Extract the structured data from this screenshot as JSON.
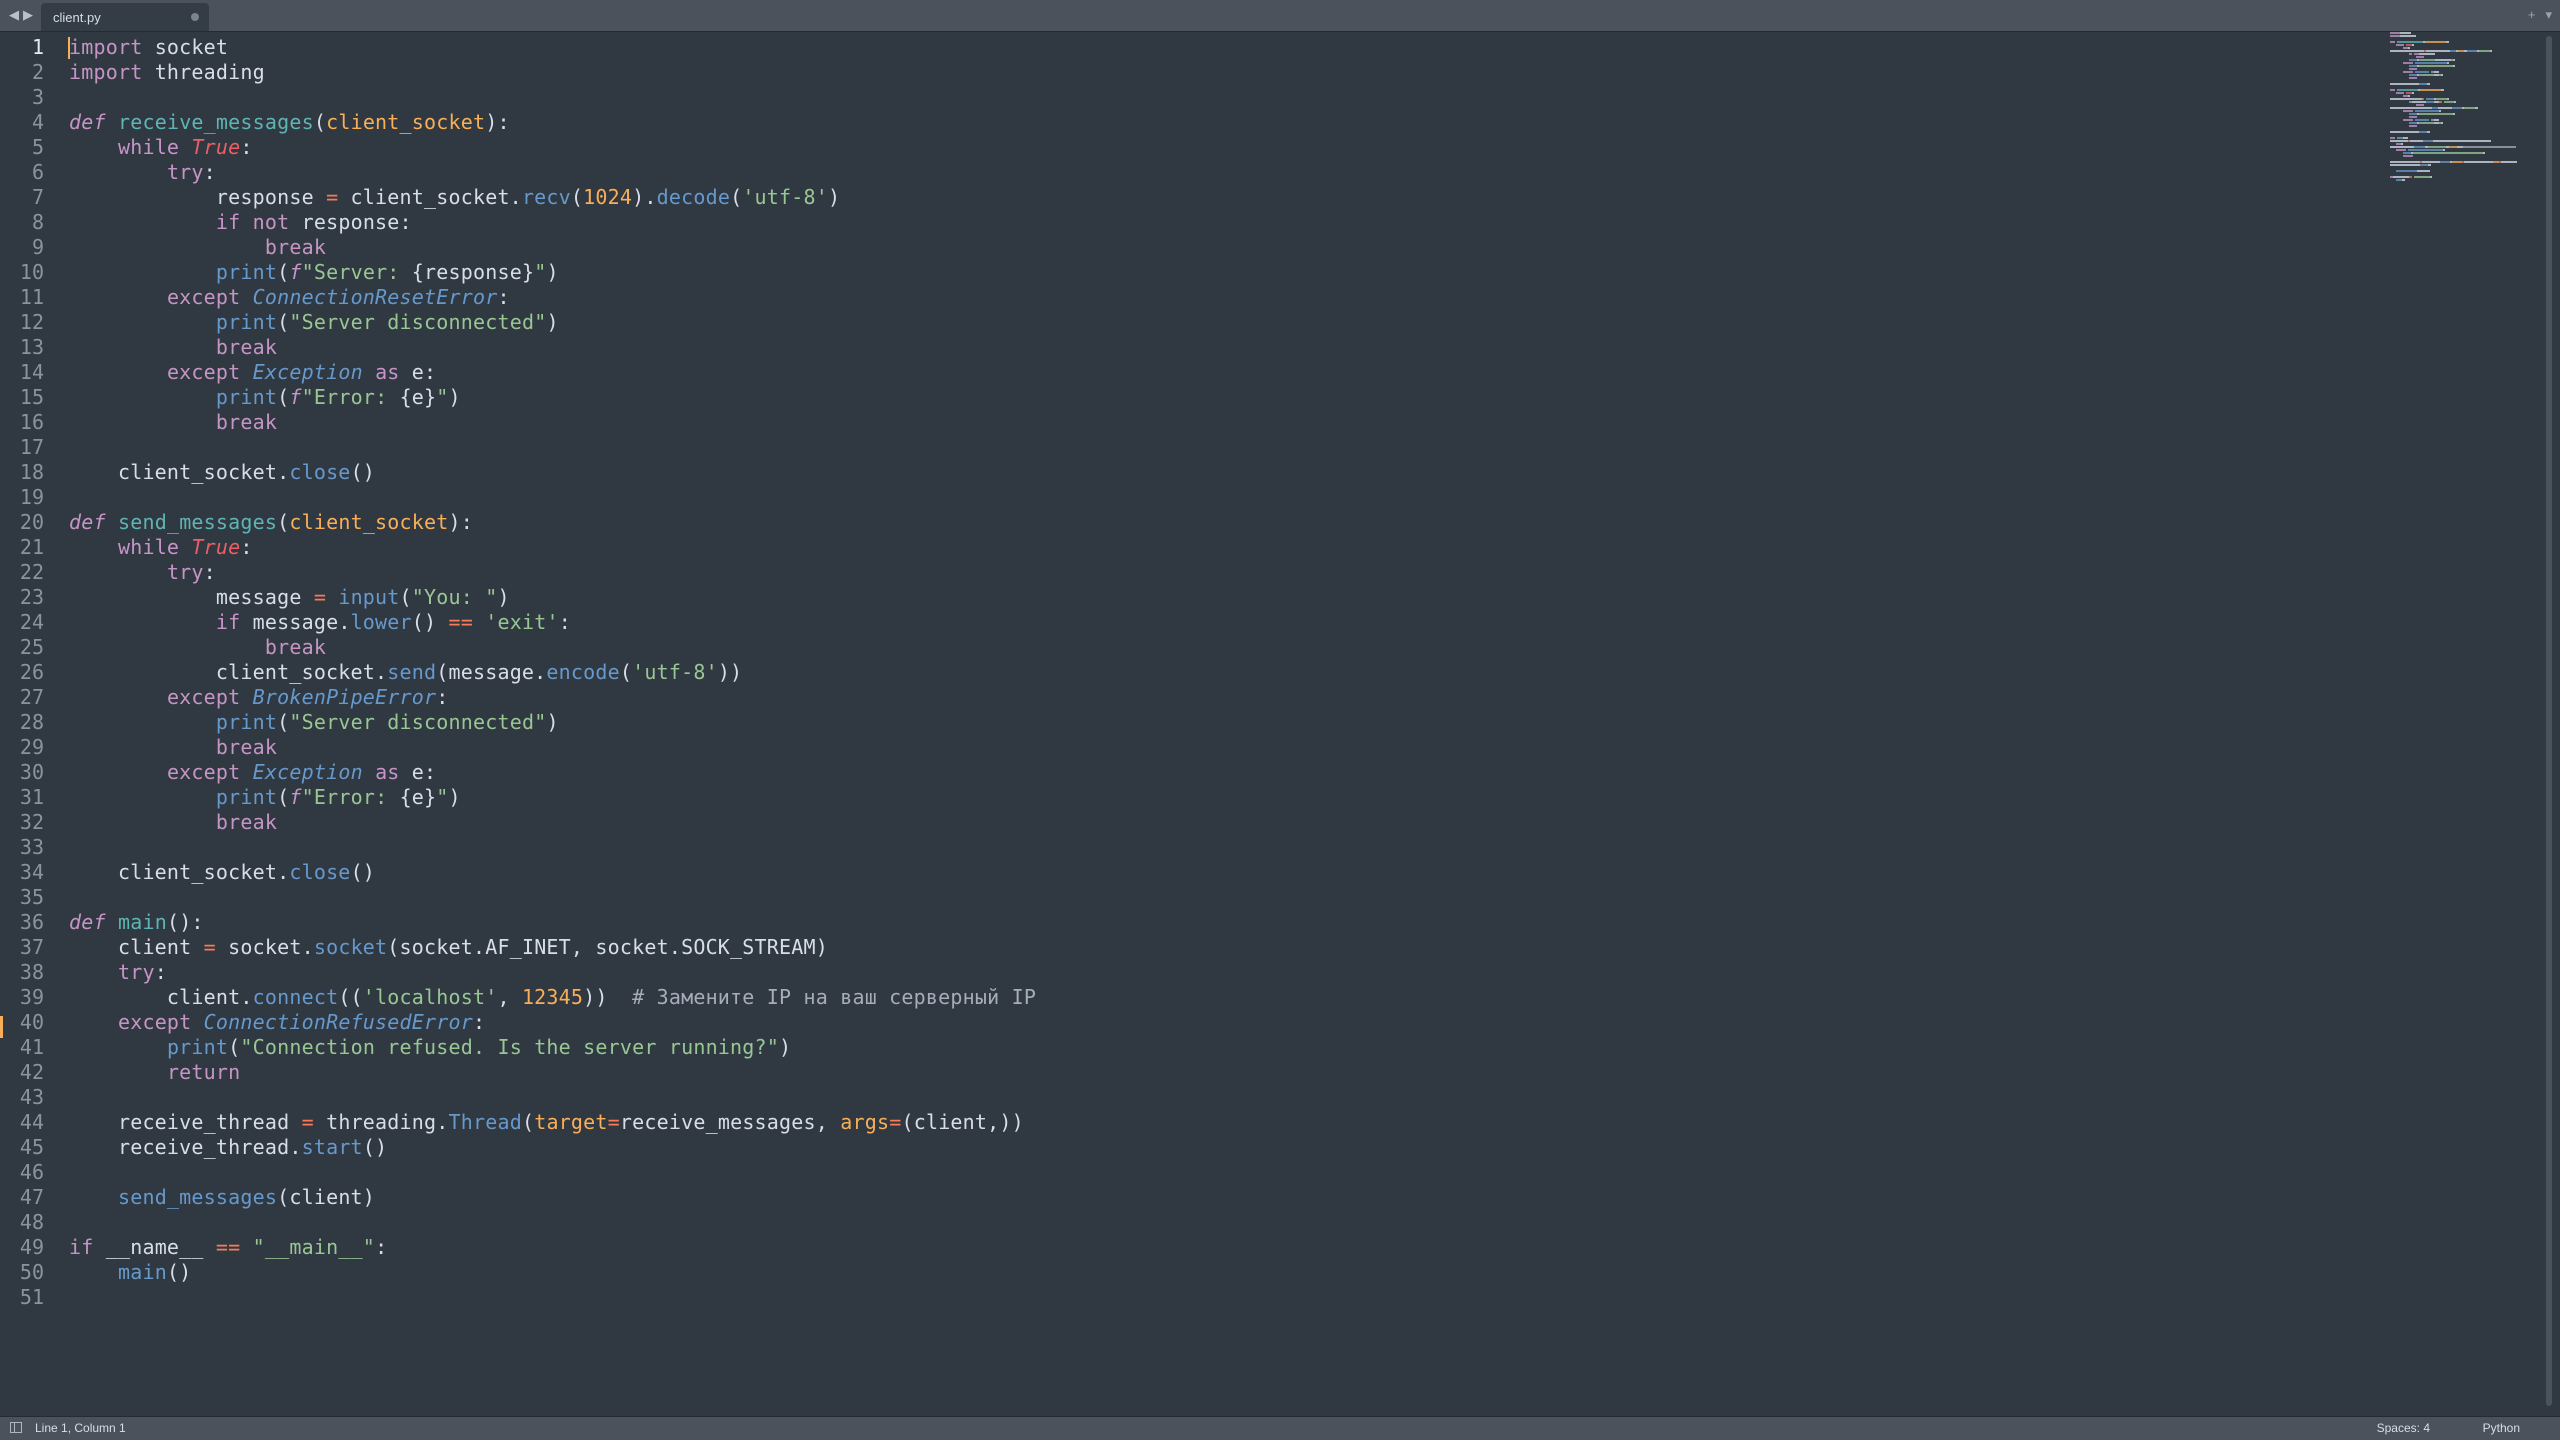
{
  "tab": {
    "filename": "client.py"
  },
  "colors": {
    "background": "#303841",
    "keyword": "#c695c6",
    "function": "#6699cc",
    "string": "#99c794",
    "number": "#f9ae58",
    "constant": "#ec5f66",
    "operator": "#f97b58",
    "comment": "#a6acb9",
    "text": "#d8dee9"
  },
  "icons": {
    "nav_left": "left-arrow-icon",
    "nav_right": "right-arrow-icon",
    "tab_close": "close-dot-icon",
    "new_tab": "plus-icon",
    "tab_menu": "chevron-down-icon",
    "panel_toggle": "panel-icon"
  },
  "editor": {
    "active_line": 1,
    "modified_line": 39,
    "lines": [
      [
        [
          "kw",
          "import"
        ],
        [
          "pn",
          " socket"
        ]
      ],
      [
        [
          "kw",
          "import"
        ],
        [
          "pn",
          " threading"
        ]
      ],
      [],
      [
        [
          "st",
          "def"
        ],
        [
          "pn",
          " "
        ],
        [
          "ent",
          "receive_messages"
        ],
        [
          "pn",
          "("
        ],
        [
          "prm",
          "client_socket"
        ],
        [
          "pn",
          "):"
        ]
      ],
      [
        [
          "pn",
          "    "
        ],
        [
          "kw",
          "while"
        ],
        [
          "pn",
          " "
        ],
        [
          "cst",
          "True"
        ],
        [
          "pn",
          ":"
        ]
      ],
      [
        [
          "pn",
          "        "
        ],
        [
          "kw",
          "try"
        ],
        [
          "pn",
          ":"
        ]
      ],
      [
        [
          "pn",
          "            response "
        ],
        [
          "op",
          "="
        ],
        [
          "pn",
          " client_socket."
        ],
        [
          "meth",
          "recv"
        ],
        [
          "pn",
          "("
        ],
        [
          "num",
          "1024"
        ],
        [
          "pn",
          ")."
        ],
        [
          "meth",
          "decode"
        ],
        [
          "pn",
          "("
        ],
        [
          "str",
          "'utf-8'"
        ],
        [
          "pn",
          ")"
        ]
      ],
      [
        [
          "pn",
          "            "
        ],
        [
          "kw",
          "if"
        ],
        [
          "pn",
          " "
        ],
        [
          "kw",
          "not"
        ],
        [
          "pn",
          " response:"
        ]
      ],
      [
        [
          "pn",
          "                "
        ],
        [
          "kw",
          "break"
        ]
      ],
      [
        [
          "pn",
          "            "
        ],
        [
          "fn",
          "print"
        ],
        [
          "pn",
          "("
        ],
        [
          "st",
          "f"
        ],
        [
          "str",
          "\"Server: "
        ],
        [
          "pn",
          "{response}"
        ],
        [
          "str",
          "\""
        ],
        [
          "pn",
          ")"
        ]
      ],
      [
        [
          "pn",
          "        "
        ],
        [
          "kw",
          "except"
        ],
        [
          "pn",
          " "
        ],
        [
          "cls",
          "ConnectionResetError"
        ],
        [
          "pn",
          ":"
        ]
      ],
      [
        [
          "pn",
          "            "
        ],
        [
          "fn",
          "print"
        ],
        [
          "pn",
          "("
        ],
        [
          "str",
          "\"Server disconnected\""
        ],
        [
          "pn",
          ")"
        ]
      ],
      [
        [
          "pn",
          "            "
        ],
        [
          "kw",
          "break"
        ]
      ],
      [
        [
          "pn",
          "        "
        ],
        [
          "kw",
          "except"
        ],
        [
          "pn",
          " "
        ],
        [
          "cls",
          "Exception"
        ],
        [
          "pn",
          " "
        ],
        [
          "kw",
          "as"
        ],
        [
          "pn",
          " e:"
        ]
      ],
      [
        [
          "pn",
          "            "
        ],
        [
          "fn",
          "print"
        ],
        [
          "pn",
          "("
        ],
        [
          "st",
          "f"
        ],
        [
          "str",
          "\"Error: "
        ],
        [
          "pn",
          "{e}"
        ],
        [
          "str",
          "\""
        ],
        [
          "pn",
          ")"
        ]
      ],
      [
        [
          "pn",
          "            "
        ],
        [
          "kw",
          "break"
        ]
      ],
      [],
      [
        [
          "pn",
          "    client_socket."
        ],
        [
          "meth",
          "close"
        ],
        [
          "pn",
          "()"
        ]
      ],
      [],
      [
        [
          "st",
          "def"
        ],
        [
          "pn",
          " "
        ],
        [
          "ent",
          "send_messages"
        ],
        [
          "pn",
          "("
        ],
        [
          "prm",
          "client_socket"
        ],
        [
          "pn",
          "):"
        ]
      ],
      [
        [
          "pn",
          "    "
        ],
        [
          "kw",
          "while"
        ],
        [
          "pn",
          " "
        ],
        [
          "cst",
          "True"
        ],
        [
          "pn",
          ":"
        ]
      ],
      [
        [
          "pn",
          "        "
        ],
        [
          "kw",
          "try"
        ],
        [
          "pn",
          ":"
        ]
      ],
      [
        [
          "pn",
          "            message "
        ],
        [
          "op",
          "="
        ],
        [
          "pn",
          " "
        ],
        [
          "fn",
          "input"
        ],
        [
          "pn",
          "("
        ],
        [
          "str",
          "\"You: \""
        ],
        [
          "pn",
          ")"
        ]
      ],
      [
        [
          "pn",
          "            "
        ],
        [
          "kw",
          "if"
        ],
        [
          "pn",
          " message."
        ],
        [
          "meth",
          "lower"
        ],
        [
          "pn",
          "() "
        ],
        [
          "op",
          "=="
        ],
        [
          "pn",
          " "
        ],
        [
          "str",
          "'exit'"
        ],
        [
          "pn",
          ":"
        ]
      ],
      [
        [
          "pn",
          "                "
        ],
        [
          "kw",
          "break"
        ]
      ],
      [
        [
          "pn",
          "            client_socket."
        ],
        [
          "meth",
          "send"
        ],
        [
          "pn",
          "(message."
        ],
        [
          "meth",
          "encode"
        ],
        [
          "pn",
          "("
        ],
        [
          "str",
          "'utf-8'"
        ],
        [
          "pn",
          "))"
        ]
      ],
      [
        [
          "pn",
          "        "
        ],
        [
          "kw",
          "except"
        ],
        [
          "pn",
          " "
        ],
        [
          "cls",
          "BrokenPipeError"
        ],
        [
          "pn",
          ":"
        ]
      ],
      [
        [
          "pn",
          "            "
        ],
        [
          "fn",
          "print"
        ],
        [
          "pn",
          "("
        ],
        [
          "str",
          "\"Server disconnected\""
        ],
        [
          "pn",
          ")"
        ]
      ],
      [
        [
          "pn",
          "            "
        ],
        [
          "kw",
          "break"
        ]
      ],
      [
        [
          "pn",
          "        "
        ],
        [
          "kw",
          "except"
        ],
        [
          "pn",
          " "
        ],
        [
          "cls",
          "Exception"
        ],
        [
          "pn",
          " "
        ],
        [
          "kw",
          "as"
        ],
        [
          "pn",
          " e:"
        ]
      ],
      [
        [
          "pn",
          "            "
        ],
        [
          "fn",
          "print"
        ],
        [
          "pn",
          "("
        ],
        [
          "st",
          "f"
        ],
        [
          "str",
          "\"Error: "
        ],
        [
          "pn",
          "{e}"
        ],
        [
          "str",
          "\""
        ],
        [
          "pn",
          ")"
        ]
      ],
      [
        [
          "pn",
          "            "
        ],
        [
          "kw",
          "break"
        ]
      ],
      [],
      [
        [
          "pn",
          "    client_socket."
        ],
        [
          "meth",
          "close"
        ],
        [
          "pn",
          "()"
        ]
      ],
      [],
      [
        [
          "st",
          "def"
        ],
        [
          "pn",
          " "
        ],
        [
          "ent",
          "main"
        ],
        [
          "pn",
          "():"
        ]
      ],
      [
        [
          "pn",
          "    client "
        ],
        [
          "op",
          "="
        ],
        [
          "pn",
          " socket."
        ],
        [
          "meth",
          "socket"
        ],
        [
          "pn",
          "(socket.AF_INET, socket.SOCK_STREAM)"
        ]
      ],
      [
        [
          "pn",
          "    "
        ],
        [
          "kw",
          "try"
        ],
        [
          "pn",
          ":"
        ]
      ],
      [
        [
          "pn",
          "        client."
        ],
        [
          "meth",
          "connect"
        ],
        [
          "pn",
          "(("
        ],
        [
          "str",
          "'localhost'"
        ],
        [
          "pn",
          ", "
        ],
        [
          "num",
          "12345"
        ],
        [
          "pn",
          "))  "
        ],
        [
          "cmt",
          "# Замените IP на ваш серверный IP"
        ]
      ],
      [
        [
          "pn",
          "    "
        ],
        [
          "kw",
          "except"
        ],
        [
          "pn",
          " "
        ],
        [
          "cls",
          "ConnectionRefusedError"
        ],
        [
          "pn",
          ":"
        ]
      ],
      [
        [
          "pn",
          "        "
        ],
        [
          "fn",
          "print"
        ],
        [
          "pn",
          "("
        ],
        [
          "str",
          "\"Connection refused. Is the server running?\""
        ],
        [
          "pn",
          ")"
        ]
      ],
      [
        [
          "pn",
          "        "
        ],
        [
          "kw",
          "return"
        ]
      ],
      [],
      [
        [
          "pn",
          "    receive_thread "
        ],
        [
          "op",
          "="
        ],
        [
          "pn",
          " threading."
        ],
        [
          "meth",
          "Thread"
        ],
        [
          "pn",
          "("
        ],
        [
          "prm",
          "target"
        ],
        [
          "op",
          "="
        ],
        [
          "pn",
          "receive_messages, "
        ],
        [
          "prm",
          "args"
        ],
        [
          "op",
          "="
        ],
        [
          "pn",
          "(client,))"
        ]
      ],
      [
        [
          "pn",
          "    receive_thread."
        ],
        [
          "meth",
          "start"
        ],
        [
          "pn",
          "()"
        ]
      ],
      [],
      [
        [
          "pn",
          "    "
        ],
        [
          "fn",
          "send_messages"
        ],
        [
          "pn",
          "(client)"
        ]
      ],
      [],
      [
        [
          "kw",
          "if"
        ],
        [
          "pn",
          " __name__ "
        ],
        [
          "op",
          "=="
        ],
        [
          "pn",
          " "
        ],
        [
          "str",
          "\"__main__\""
        ],
        [
          "pn",
          ":"
        ]
      ],
      [
        [
          "pn",
          "    "
        ],
        [
          "fn",
          "main"
        ],
        [
          "pn",
          "()"
        ]
      ],
      []
    ]
  },
  "status": {
    "cursor_position": "Line 1, Column 1",
    "indentation": "Spaces: 4",
    "syntax": "Python"
  }
}
